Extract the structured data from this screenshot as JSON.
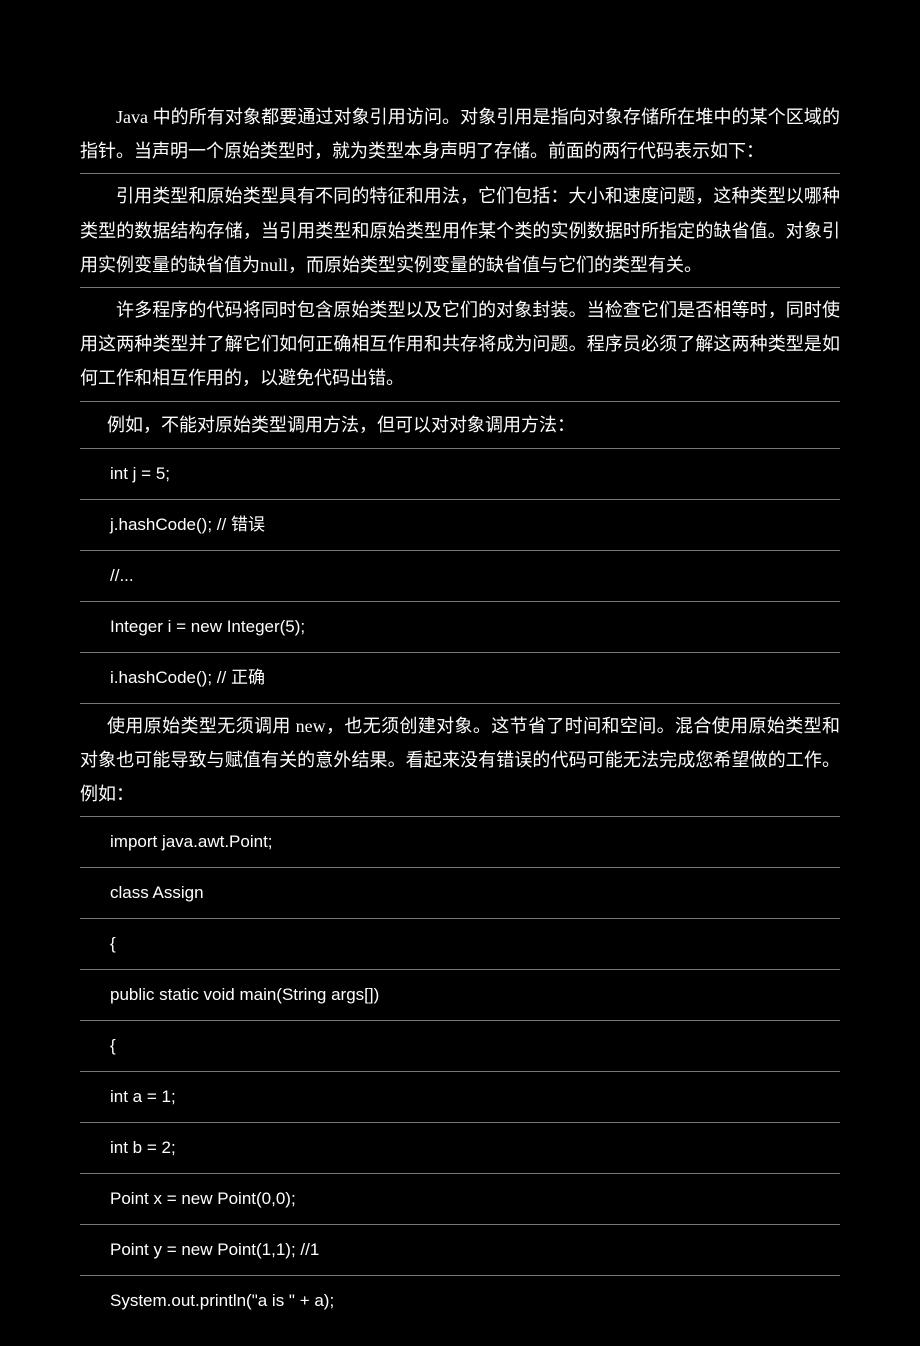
{
  "paragraphs": {
    "p1": "Java 中的所有对象都要通过对象引用访问。对象引用是指向对象存储所在堆中的某个区域的指针。当声明一个原始类型时，就为类型本身声明了存储。前面的两行代码表示如下：",
    "p2": "引用类型和原始类型具有不同的特征和用法，它们包括：大小和速度问题，这种类型以哪种类型的数据结构存储，当引用类型和原始类型用作某个类的实例数据时所指定的缺省值。对象引用实例变量的缺省值为null，而原始类型实例变量的缺省值与它们的类型有关。",
    "p3": "许多程序的代码将同时包含原始类型以及它们的对象封装。当检查它们是否相等时，同时使用这两种类型并了解它们如何正确相互作用和共存将成为问题。程序员必须了解这两种类型是如何工作和相互作用的，以避免代码出错。",
    "p4": "例如，不能对原始类型调用方法，但可以对对象调用方法：",
    "p5": "使用原始类型无须调用 new，也无须创建对象。这节省了时间和空间。混合使用原始类型和对象也可能导致与赋值有关的意外结果。看起来没有错误的代码可能无法完成您希望做的工作。例如："
  },
  "code": {
    "c1": "int j = 5;",
    "c2_code": "j.hashCode();   // ",
    "c2_comment": "错误",
    "c3": "//...",
    "c4": "Integer i = new Integer(5);",
    "c5_code": "i.hashCode();   // ",
    "c5_comment": "正确",
    "c6": "import java.awt.Point;",
    "c7": "class Assign",
    "c8": "{",
    "c9": "public static void main(String args[])",
    "c10": "{",
    "c11": "int a = 1;",
    "c12": "int b = 2;",
    "c13": "Point x = new Point(0,0);",
    "c14": "Point y = new Point(1,1);                //1",
    "c15": "System.out.println(\"a is \" + a);"
  }
}
